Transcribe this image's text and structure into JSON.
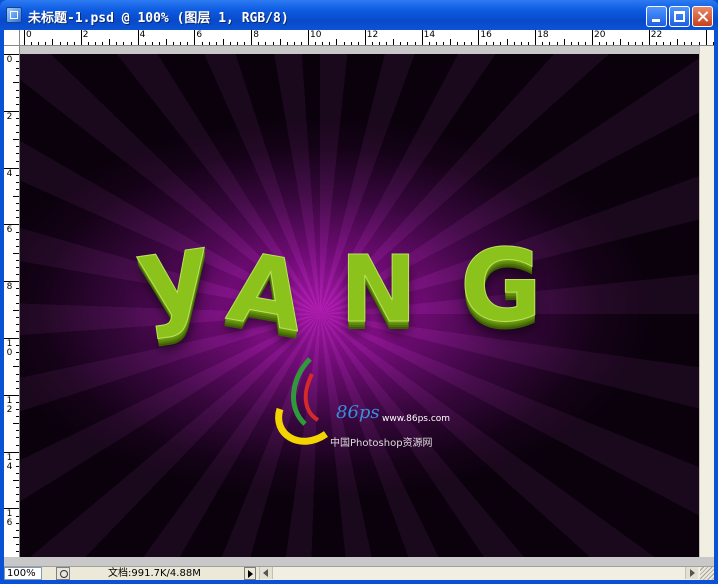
{
  "window": {
    "title": "未标题-1.psd @ 100% (图层 1, RGB/8)",
    "icons": {
      "app": "photoshop-document-icon",
      "minimize": "minimize-icon",
      "maximize": "maximize-icon",
      "close": "close-icon"
    },
    "colors": {
      "titlebar": "#0b54d6",
      "close": "#c7401c"
    }
  },
  "rulers": {
    "horizontal": [
      "0",
      "2",
      "4",
      "6",
      "8",
      "10",
      "12",
      "14",
      "16",
      "18",
      "20",
      "22"
    ],
    "vertical": [
      "0",
      "2",
      "4",
      "6",
      "8",
      "10",
      "12",
      "14",
      "16"
    ]
  },
  "canvas": {
    "letters": [
      "y",
      "A",
      "N",
      "G"
    ],
    "watermark": {
      "number": "86ps",
      "url": "www.86ps.com",
      "subtitle": "中国Photoshop资源网"
    },
    "colors": {
      "text_green": "#8bc21b",
      "glow": "#b21ab4",
      "background": "#0c010e"
    }
  },
  "status_bar": {
    "zoom": "100%",
    "doc_info": "文档:991.7K/4.88M",
    "icons": {
      "navigator": "navigator-icon",
      "menu_arrow": "triangle-right-icon",
      "scroll_left": "scroll-left-icon",
      "scroll_right": "scroll-right-icon",
      "resize": "resize-grip-icon"
    }
  }
}
